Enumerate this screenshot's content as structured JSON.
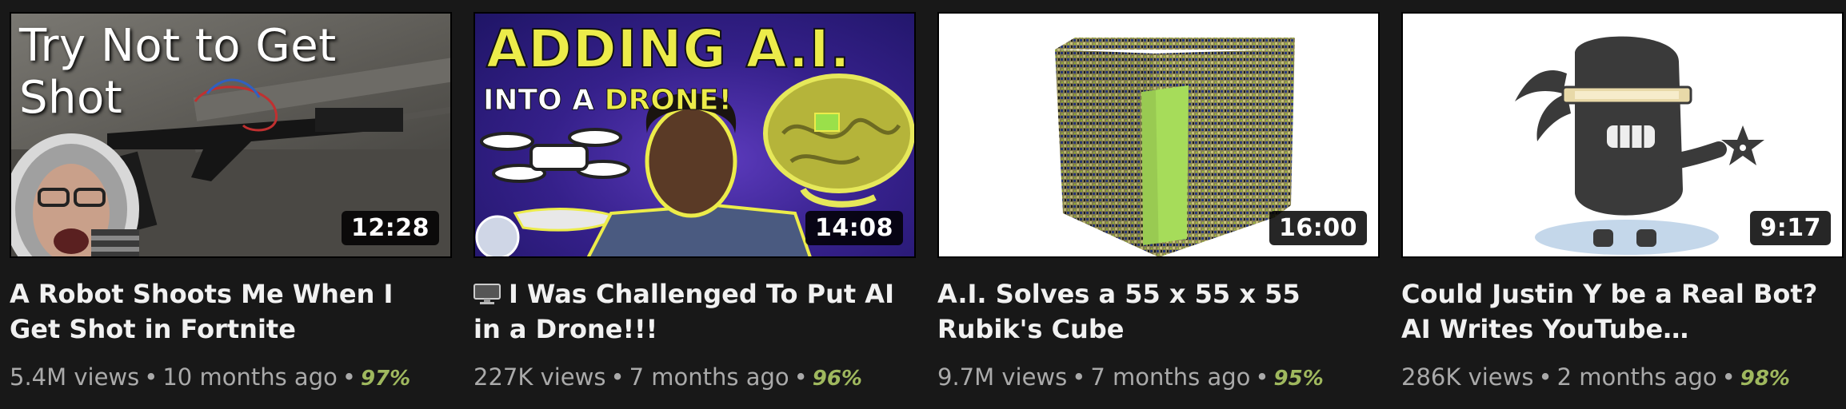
{
  "colors": {
    "background": "#181818",
    "title": "#f1f1f1",
    "meta": "#aaaaaa",
    "rating": "#9fb85e"
  },
  "videos": [
    {
      "thumb_caption": "Try Not to Get Shot",
      "duration": "12:28",
      "title": "A Robot Shoots Me When I Get Shot in Fortnite",
      "views": "5.4M views",
      "age": "10 months ago",
      "rating": "97%"
    },
    {
      "thumb_caption_line1": "ADDING A.I.",
      "thumb_caption_line2a": "INTO A ",
      "thumb_caption_line2b": "DRONE!",
      "duration": "14:08",
      "title_icon": "monitor-icon",
      "title": "I Was Challenged To Put AI in a Drone!!!",
      "views": "227K views",
      "age": "7 months ago",
      "rating": "96%"
    },
    {
      "duration": "16:00",
      "title": "A.I. Solves a 55 x 55 x 55 Rubik's Cube",
      "views": "9.7M views",
      "age": "7 months ago",
      "rating": "95%"
    },
    {
      "duration": "9:17",
      "title": "Could Justin Y be a Real Bot? AI Writes YouTube…",
      "views": "286K views",
      "age": "2 months ago",
      "rating": "98%"
    }
  ]
}
